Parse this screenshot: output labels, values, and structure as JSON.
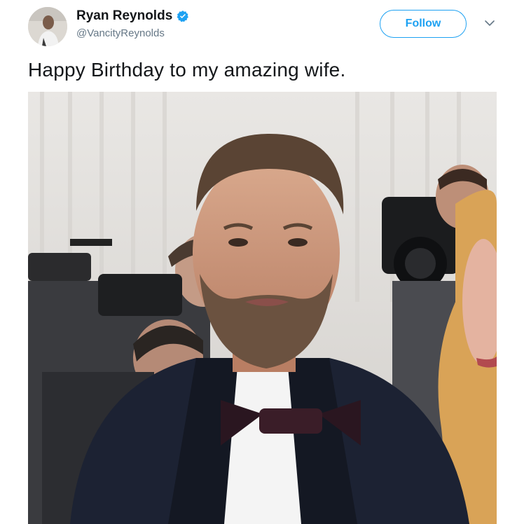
{
  "tweet": {
    "author": {
      "name": "Ryan Reynolds",
      "handle": "@VancityReynolds",
      "verified": true,
      "verified_icon": "verified-badge-icon"
    },
    "follow_label": "Follow",
    "menu_icon": "chevron-down-icon",
    "text": "Happy Birthday to my amazing wife.",
    "media": {
      "alt": "Photo of a bearded man in a tuxedo with a bow tie at a red carpet event, photographers in the background, a blonde woman at right edge"
    }
  },
  "colors": {
    "accent": "#1da1f2",
    "name_text": "#14171a",
    "secondary_text": "#657786"
  }
}
